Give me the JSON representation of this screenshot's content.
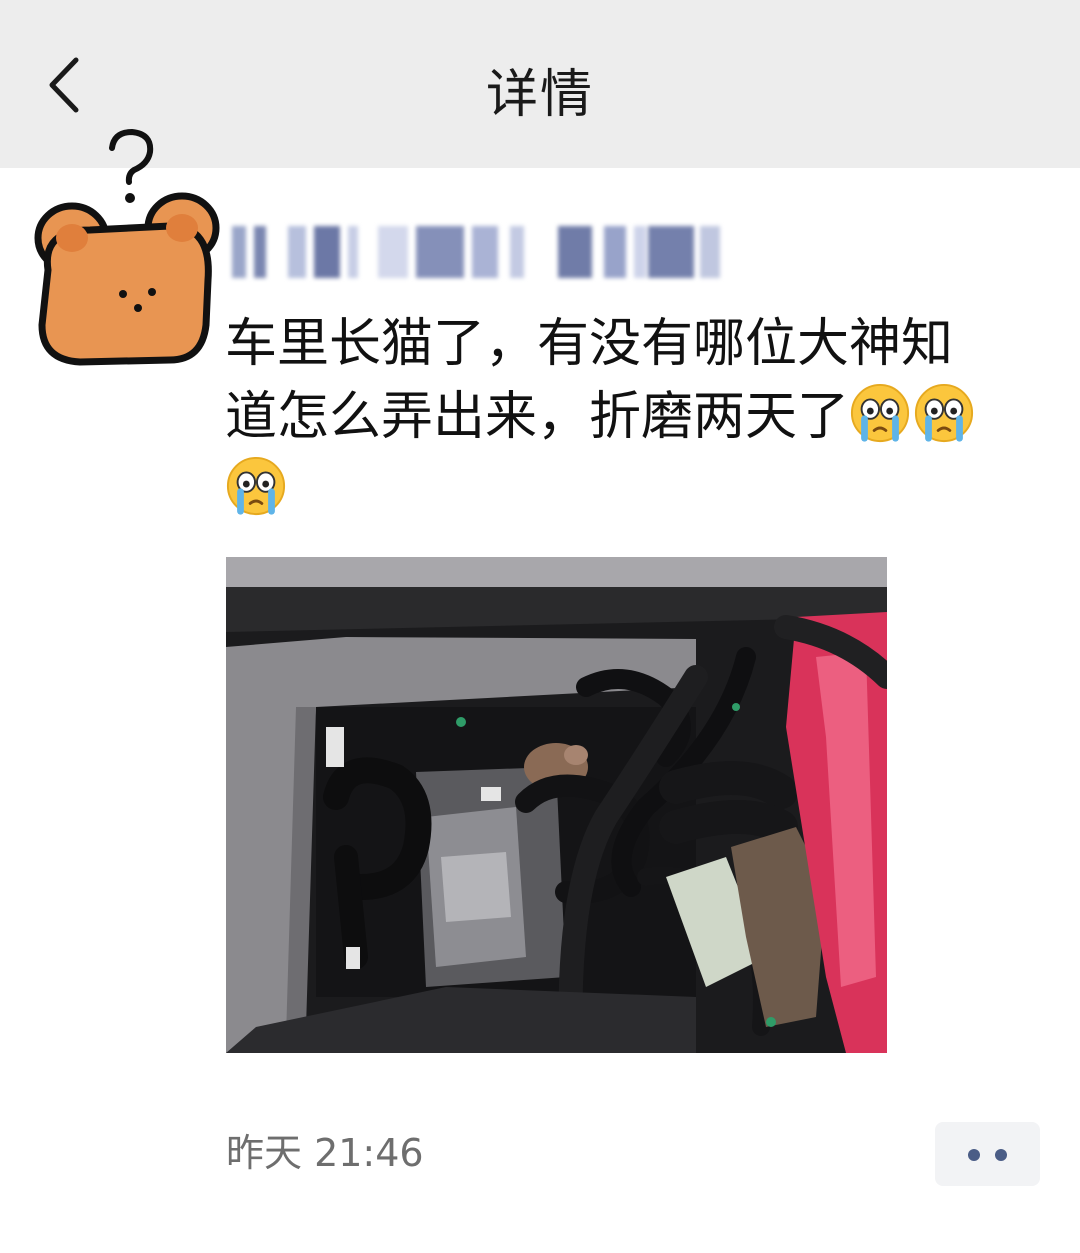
{
  "header": {
    "title": "详情",
    "back_icon": "chevron-left-icon"
  },
  "post": {
    "author_avatar": "cartoon-bear-with-question-mark",
    "text_line1": "车里长猫了，有没有哪位大神知",
    "text_line2": "道怎么弄出来，折磨两天了",
    "emoji": "crying-face-emoji",
    "emoji_count": 3,
    "photo_description_icon": "car-engine-bay-photo",
    "timestamp": "昨天 21:46",
    "more_icon": "two-dots-more-icon"
  },
  "colors": {
    "header_bg": "#ededed",
    "more_dots": "#4b5d86",
    "timestamp": "#6e6e6e"
  }
}
